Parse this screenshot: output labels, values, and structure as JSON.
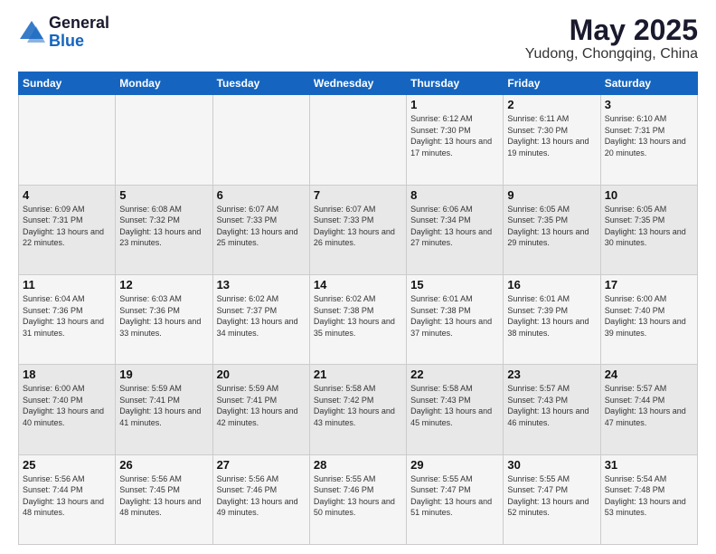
{
  "header": {
    "logo_line1": "General",
    "logo_line2": "Blue",
    "month_title": "May 2025",
    "location": "Yudong, Chongqing, China"
  },
  "weekdays": [
    "Sunday",
    "Monday",
    "Tuesday",
    "Wednesday",
    "Thursday",
    "Friday",
    "Saturday"
  ],
  "weeks": [
    [
      {
        "day": "",
        "sunrise": "",
        "sunset": "",
        "daylight": ""
      },
      {
        "day": "",
        "sunrise": "",
        "sunset": "",
        "daylight": ""
      },
      {
        "day": "",
        "sunrise": "",
        "sunset": "",
        "daylight": ""
      },
      {
        "day": "",
        "sunrise": "",
        "sunset": "",
        "daylight": ""
      },
      {
        "day": "1",
        "sunrise": "Sunrise: 6:12 AM",
        "sunset": "Sunset: 7:30 PM",
        "daylight": "Daylight: 13 hours and 17 minutes."
      },
      {
        "day": "2",
        "sunrise": "Sunrise: 6:11 AM",
        "sunset": "Sunset: 7:30 PM",
        "daylight": "Daylight: 13 hours and 19 minutes."
      },
      {
        "day": "3",
        "sunrise": "Sunrise: 6:10 AM",
        "sunset": "Sunset: 7:31 PM",
        "daylight": "Daylight: 13 hours and 20 minutes."
      }
    ],
    [
      {
        "day": "4",
        "sunrise": "Sunrise: 6:09 AM",
        "sunset": "Sunset: 7:31 PM",
        "daylight": "Daylight: 13 hours and 22 minutes."
      },
      {
        "day": "5",
        "sunrise": "Sunrise: 6:08 AM",
        "sunset": "Sunset: 7:32 PM",
        "daylight": "Daylight: 13 hours and 23 minutes."
      },
      {
        "day": "6",
        "sunrise": "Sunrise: 6:07 AM",
        "sunset": "Sunset: 7:33 PM",
        "daylight": "Daylight: 13 hours and 25 minutes."
      },
      {
        "day": "7",
        "sunrise": "Sunrise: 6:07 AM",
        "sunset": "Sunset: 7:33 PM",
        "daylight": "Daylight: 13 hours and 26 minutes."
      },
      {
        "day": "8",
        "sunrise": "Sunrise: 6:06 AM",
        "sunset": "Sunset: 7:34 PM",
        "daylight": "Daylight: 13 hours and 27 minutes."
      },
      {
        "day": "9",
        "sunrise": "Sunrise: 6:05 AM",
        "sunset": "Sunset: 7:35 PM",
        "daylight": "Daylight: 13 hours and 29 minutes."
      },
      {
        "day": "10",
        "sunrise": "Sunrise: 6:05 AM",
        "sunset": "Sunset: 7:35 PM",
        "daylight": "Daylight: 13 hours and 30 minutes."
      }
    ],
    [
      {
        "day": "11",
        "sunrise": "Sunrise: 6:04 AM",
        "sunset": "Sunset: 7:36 PM",
        "daylight": "Daylight: 13 hours and 31 minutes."
      },
      {
        "day": "12",
        "sunrise": "Sunrise: 6:03 AM",
        "sunset": "Sunset: 7:36 PM",
        "daylight": "Daylight: 13 hours and 33 minutes."
      },
      {
        "day": "13",
        "sunrise": "Sunrise: 6:02 AM",
        "sunset": "Sunset: 7:37 PM",
        "daylight": "Daylight: 13 hours and 34 minutes."
      },
      {
        "day": "14",
        "sunrise": "Sunrise: 6:02 AM",
        "sunset": "Sunset: 7:38 PM",
        "daylight": "Daylight: 13 hours and 35 minutes."
      },
      {
        "day": "15",
        "sunrise": "Sunrise: 6:01 AM",
        "sunset": "Sunset: 7:38 PM",
        "daylight": "Daylight: 13 hours and 37 minutes."
      },
      {
        "day": "16",
        "sunrise": "Sunrise: 6:01 AM",
        "sunset": "Sunset: 7:39 PM",
        "daylight": "Daylight: 13 hours and 38 minutes."
      },
      {
        "day": "17",
        "sunrise": "Sunrise: 6:00 AM",
        "sunset": "Sunset: 7:40 PM",
        "daylight": "Daylight: 13 hours and 39 minutes."
      }
    ],
    [
      {
        "day": "18",
        "sunrise": "Sunrise: 6:00 AM",
        "sunset": "Sunset: 7:40 PM",
        "daylight": "Daylight: 13 hours and 40 minutes."
      },
      {
        "day": "19",
        "sunrise": "Sunrise: 5:59 AM",
        "sunset": "Sunset: 7:41 PM",
        "daylight": "Daylight: 13 hours and 41 minutes."
      },
      {
        "day": "20",
        "sunrise": "Sunrise: 5:59 AM",
        "sunset": "Sunset: 7:41 PM",
        "daylight": "Daylight: 13 hours and 42 minutes."
      },
      {
        "day": "21",
        "sunrise": "Sunrise: 5:58 AM",
        "sunset": "Sunset: 7:42 PM",
        "daylight": "Daylight: 13 hours and 43 minutes."
      },
      {
        "day": "22",
        "sunrise": "Sunrise: 5:58 AM",
        "sunset": "Sunset: 7:43 PM",
        "daylight": "Daylight: 13 hours and 45 minutes."
      },
      {
        "day": "23",
        "sunrise": "Sunrise: 5:57 AM",
        "sunset": "Sunset: 7:43 PM",
        "daylight": "Daylight: 13 hours and 46 minutes."
      },
      {
        "day": "24",
        "sunrise": "Sunrise: 5:57 AM",
        "sunset": "Sunset: 7:44 PM",
        "daylight": "Daylight: 13 hours and 47 minutes."
      }
    ],
    [
      {
        "day": "25",
        "sunrise": "Sunrise: 5:56 AM",
        "sunset": "Sunset: 7:44 PM",
        "daylight": "Daylight: 13 hours and 48 minutes."
      },
      {
        "day": "26",
        "sunrise": "Sunrise: 5:56 AM",
        "sunset": "Sunset: 7:45 PM",
        "daylight": "Daylight: 13 hours and 48 minutes."
      },
      {
        "day": "27",
        "sunrise": "Sunrise: 5:56 AM",
        "sunset": "Sunset: 7:46 PM",
        "daylight": "Daylight: 13 hours and 49 minutes."
      },
      {
        "day": "28",
        "sunrise": "Sunrise: 5:55 AM",
        "sunset": "Sunset: 7:46 PM",
        "daylight": "Daylight: 13 hours and 50 minutes."
      },
      {
        "day": "29",
        "sunrise": "Sunrise: 5:55 AM",
        "sunset": "Sunset: 7:47 PM",
        "daylight": "Daylight: 13 hours and 51 minutes."
      },
      {
        "day": "30",
        "sunrise": "Sunrise: 5:55 AM",
        "sunset": "Sunset: 7:47 PM",
        "daylight": "Daylight: 13 hours and 52 minutes."
      },
      {
        "day": "31",
        "sunrise": "Sunrise: 5:54 AM",
        "sunset": "Sunset: 7:48 PM",
        "daylight": "Daylight: 13 hours and 53 minutes."
      }
    ]
  ]
}
